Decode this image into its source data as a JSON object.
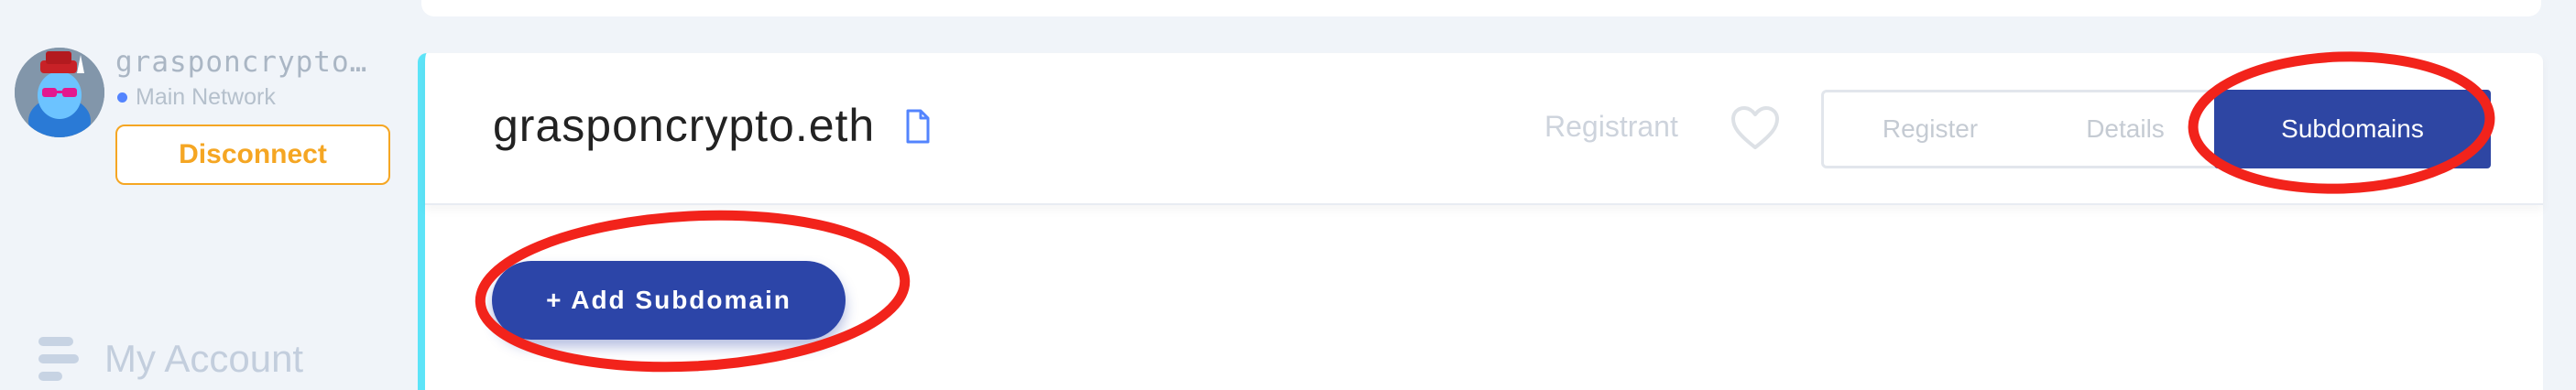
{
  "account": {
    "name": "grasponcrypto.eth",
    "network": "Main Network",
    "disconnect_label": "Disconnect"
  },
  "nav": {
    "my_account_label": "My Account"
  },
  "domain": {
    "name": "grasponcrypto.eth",
    "registrant_label": "Registrant"
  },
  "tabs": [
    {
      "label": "Register",
      "active": false
    },
    {
      "label": "Details",
      "active": false
    },
    {
      "label": "Subdomains",
      "active": true
    }
  ],
  "actions": {
    "add_subdomain_label": "+ Add Subdomain"
  },
  "colors": {
    "primary": "#2e46a3",
    "accent_cyan": "#5de4f8",
    "warning_orange": "#f5a623",
    "annotation_red": "#f2231b"
  }
}
